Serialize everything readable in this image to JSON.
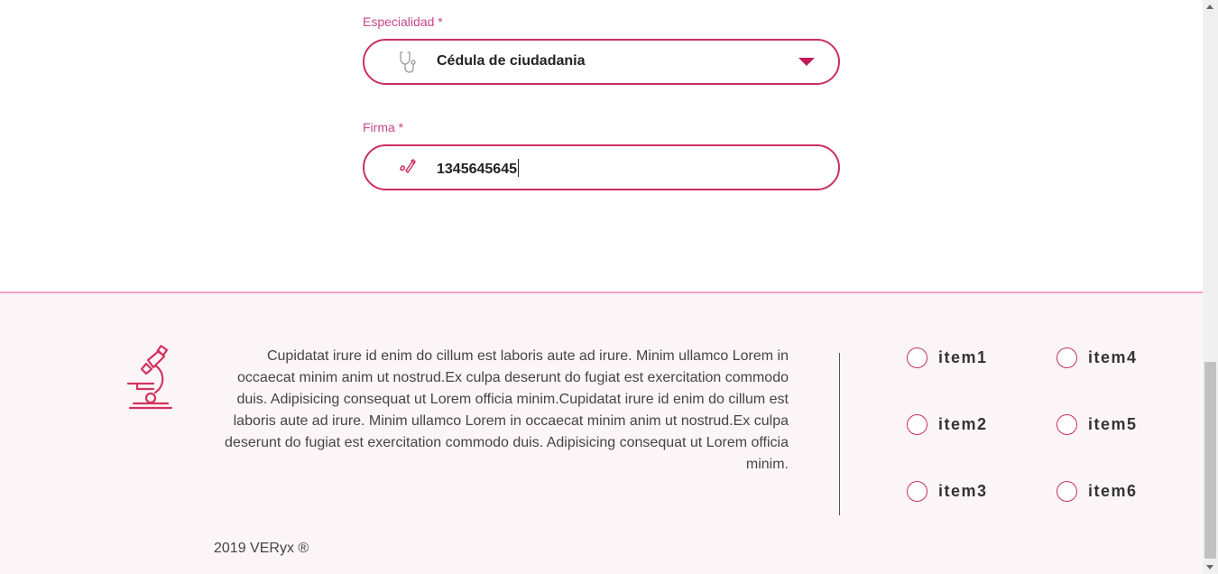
{
  "form": {
    "specialty": {
      "label": "Especialidad *",
      "value": "Cédula de ciudadania",
      "icon": "stethoscope-icon"
    },
    "signature": {
      "label": "Firma *",
      "value": "1345645645",
      "icon": "signature-icon"
    }
  },
  "footer": {
    "logo_icon": "microscope-icon",
    "description": "Cupidatat irure id enim do cillum est laboris aute ad irure. Minim ullamco Lorem in occaecat minim anim ut nostrud.Ex culpa deserunt do fugiat est exercitation commodo duis. Adipisicing consequat ut Lorem officia minim.Cupidatat irure id enim do cillum est laboris aute ad irure. Minim ullamco Lorem in occaecat minim anim ut nostrud.Ex culpa deserunt do fugiat est exercitation commodo duis. Adipisicing consequat ut Lorem officia minim.",
    "items": [
      {
        "label": "item1"
      },
      {
        "label": "item2"
      },
      {
        "label": "item3"
      },
      {
        "label": "item4"
      },
      {
        "label": "item5"
      },
      {
        "label": "item6"
      }
    ],
    "copyright": "2019 VERyx ®"
  },
  "colors": {
    "accent": "#c9305f",
    "label": "#c9468a",
    "footer_bg": "#fcf5f7",
    "footer_border": "#f2a3c2"
  }
}
